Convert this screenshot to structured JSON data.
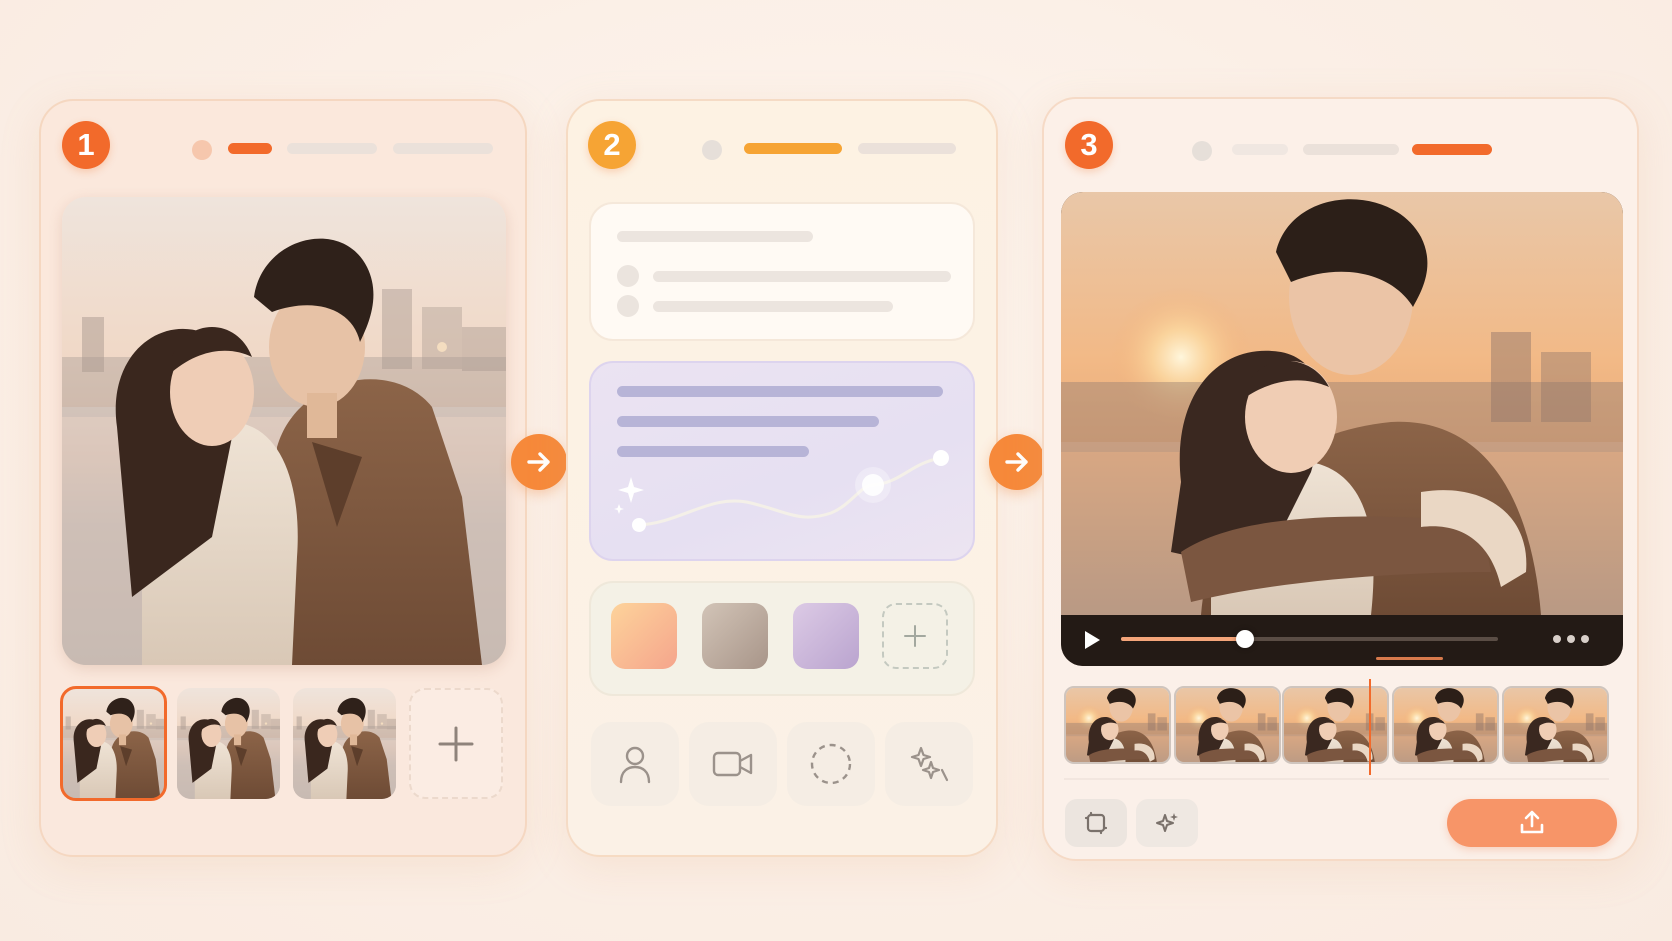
{
  "steps": [
    {
      "number": "1"
    },
    {
      "number": "2"
    },
    {
      "number": "3"
    }
  ],
  "colors": {
    "accent": "#f26a2b",
    "accent_soft": "#f79568",
    "step2_accent": "#f6a434",
    "arrow": "#f6893a",
    "track": "#ebe1da"
  },
  "panel1": {
    "photos_count_visible": 3,
    "selected_photo_index": 0,
    "add_photo_icon": "plus-icon"
  },
  "panel2": {
    "swatches": [
      {
        "name": "peach-gradient",
        "from": "#fbc79b",
        "to": "#f6a98a"
      },
      {
        "name": "taupe-gradient",
        "from": "#c8b9ad",
        "to": "#a8988c"
      },
      {
        "name": "lavender-gradient",
        "from": "#d8c4e2",
        "to": "#bba7d0"
      }
    ],
    "tools": [
      "person-icon",
      "video-camera-icon",
      "dashed-circle-icon",
      "magic-wand-icon"
    ],
    "ai_card_icon": "sparkle-icon"
  },
  "panel3": {
    "playback_progress": 0.33,
    "buffered_progress": 0.42,
    "timeline_frames_count": 5,
    "playhead_position": 0.56,
    "tools": [
      "crop-icon",
      "sparkle-icon"
    ],
    "export_icon": "upload-icon"
  }
}
